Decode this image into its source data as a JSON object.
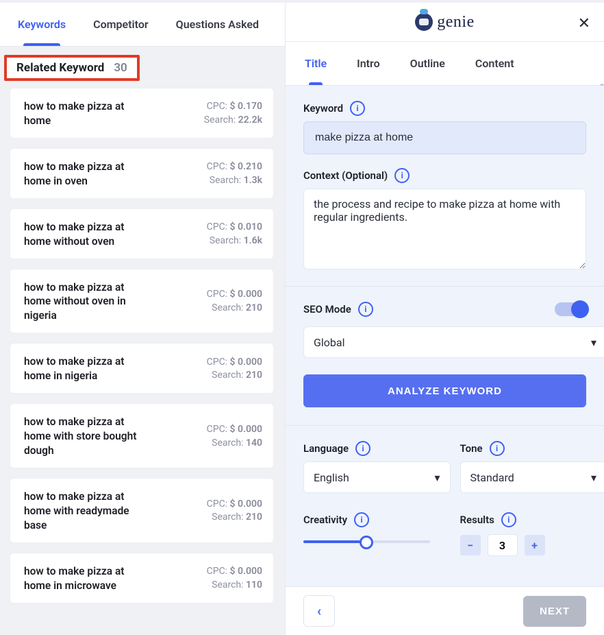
{
  "brand": {
    "name": "genie"
  },
  "left_tabs": [
    "Keywords",
    "Competitor",
    "Questions Asked"
  ],
  "left_active_tab": 0,
  "related_header": {
    "title": "Related Keyword",
    "count": "30"
  },
  "keywords": [
    {
      "text": "how to make pizza at home",
      "cpc": "$ 0.170",
      "search": "22.2k"
    },
    {
      "text": "how to make pizza at home in oven",
      "cpc": "$ 0.210",
      "search": "1.3k"
    },
    {
      "text": "how to make pizza at home without oven",
      "cpc": "$ 0.010",
      "search": "1.6k"
    },
    {
      "text": "how to make pizza at home without oven in nigeria",
      "cpc": "$ 0.000",
      "search": "210"
    },
    {
      "text": "how to make pizza at home in nigeria",
      "cpc": "$ 0.000",
      "search": "210"
    },
    {
      "text": "how to make pizza at home with store bought dough",
      "cpc": "$ 0.000",
      "search": "140"
    },
    {
      "text": "how to make pizza at home with readymade base",
      "cpc": "$ 0.000",
      "search": "210"
    },
    {
      "text": "how to make pizza at home in microwave",
      "cpc": "$ 0.000",
      "search": "110"
    }
  ],
  "cpc_label": "CPC: ",
  "search_label": "Search: ",
  "right_tabs": [
    "Title",
    "Intro",
    "Outline",
    "Content"
  ],
  "right_active_tab": 0,
  "form": {
    "keyword_label": "Keyword",
    "keyword_value": "make pizza at home",
    "context_label": "Context (Optional)",
    "context_value": "the process and recipe to make pizza at home with regular ingredients.",
    "seo_mode_label": "SEO Mode",
    "seo_mode_on": true,
    "region_select": "Global",
    "analyze_label": "ANALYZE KEYWORD",
    "language_label": "Language",
    "language_value": "English",
    "tone_label": "Tone",
    "tone_value": "Standard",
    "creativity_label": "Creativity",
    "creativity_pct": 50,
    "results_label": "Results",
    "results_value": "3"
  },
  "footer": {
    "next": "NEXT"
  }
}
